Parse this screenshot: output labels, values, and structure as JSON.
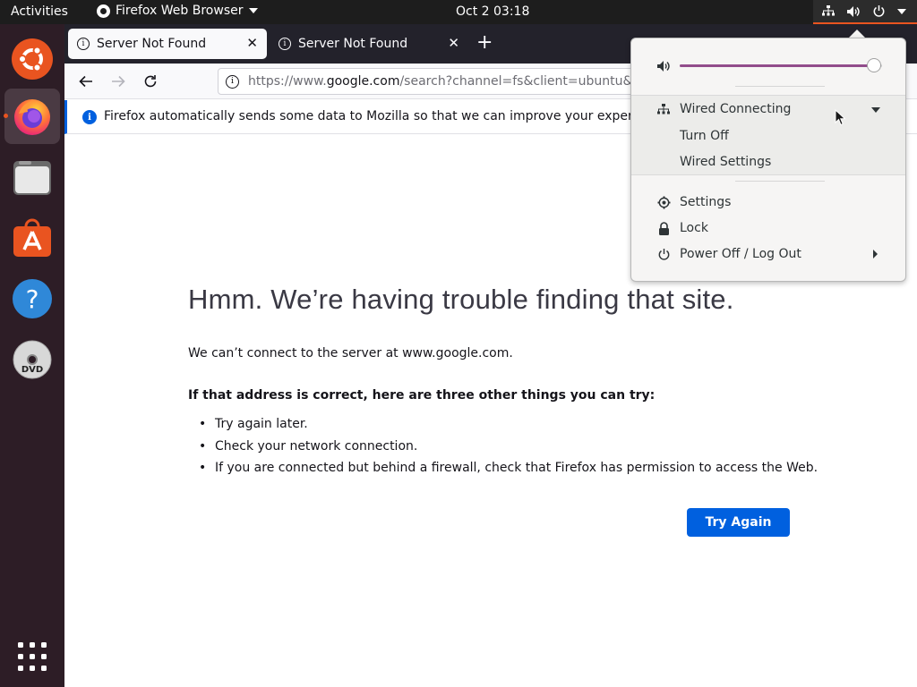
{
  "topbar": {
    "activities": "Activities",
    "app_name": "Firefox Web Browser",
    "clock": "Oct 2  03:18",
    "tray_icons": [
      "network-wired-icon",
      "volume-icon",
      "power-icon",
      "chevron-down-icon"
    ]
  },
  "dock": {
    "items": [
      {
        "name": "ubuntu-logo-icon"
      },
      {
        "name": "firefox-icon",
        "active": true
      },
      {
        "name": "files-icon"
      },
      {
        "name": "software-center-icon"
      },
      {
        "name": "help-icon"
      },
      {
        "name": "dvd-icon"
      },
      {
        "name": "show-apps-grid-icon"
      }
    ]
  },
  "browser": {
    "tabs": [
      {
        "title": "Server Not Found",
        "selected": true
      },
      {
        "title": "Server Not Found",
        "selected": false
      }
    ],
    "url": {
      "prefix": "https://www.",
      "domain": "google.com",
      "rest": "/search?channel=fs&client=ubuntu&"
    },
    "notice": "Firefox automatically sends some data to Mozilla so that we can improve your experience"
  },
  "error_page": {
    "title": "Hmm. We’re having trouble finding that site.",
    "description": "We can’t connect to the server at www.google.com.",
    "hint": "If that address is correct, here are three other things you can try:",
    "tips": [
      "Try again later.",
      "Check your network connection.",
      "If you are connected but behind a firewall, check that Firefox has permission to access the Web."
    ],
    "button": "Try Again"
  },
  "system_menu": {
    "volume_level": 0.96,
    "wired": "Wired Connecting",
    "turn_off": "Turn Off",
    "wired_settings": "Wired Settings",
    "settings": "Settings",
    "lock": "Lock",
    "power": "Power Off / Log Out"
  },
  "colors": {
    "accent_orange": "#e95420",
    "firefox_blue": "#0060df",
    "slider_purple": "#924d8b",
    "dock_bg": "#2d1d26"
  }
}
